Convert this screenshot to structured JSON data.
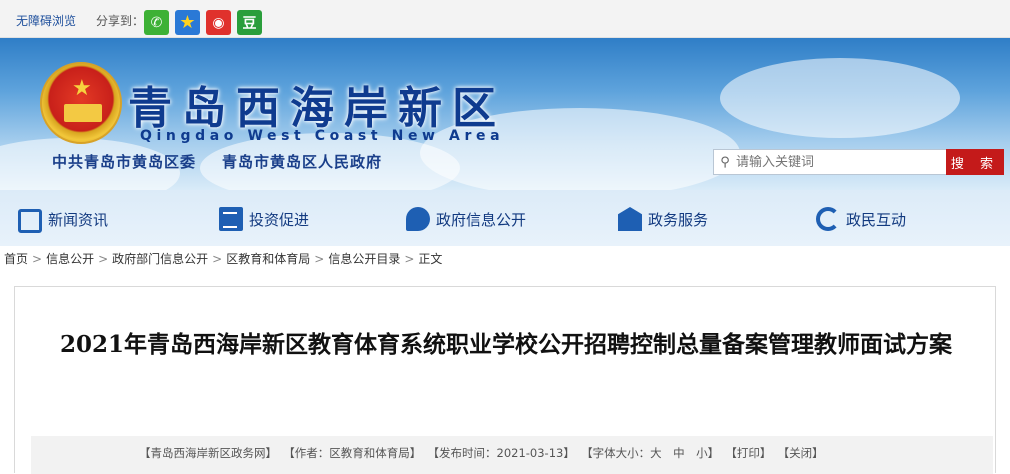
{
  "topbar": {
    "access_label": "无障碍浏览",
    "share_label": "分享到：",
    "share_icons": {
      "wechat": "wechat-icon",
      "qzone": "qzone-icon",
      "weibo": "weibo-icon",
      "douban": "豆"
    }
  },
  "header": {
    "title": "青岛西海岸新区",
    "subtitle": "Qingdao West Coast New Area",
    "org1": "中共青岛市黄岛区委",
    "org2": "青岛市黄岛区人民政府"
  },
  "search": {
    "placeholder": "请输入关键词",
    "button_label": "搜 索"
  },
  "nav": [
    {
      "label": "新闻资讯",
      "icon": "tv-icon"
    },
    {
      "label": "投资促进",
      "icon": "document-icon"
    },
    {
      "label": "政府信息公开",
      "icon": "chat-icon"
    },
    {
      "label": "政务服务",
      "icon": "building-icon"
    },
    {
      "label": "政民互动",
      "icon": "refresh-icon"
    }
  ],
  "breadcrumb": [
    "首页",
    "信息公开",
    "政府部门信息公开",
    "区教育和体育局",
    "信息公开目录",
    "正文"
  ],
  "article": {
    "title": "2021年青岛西海岸新区教育体育系统职业学校公开招聘控制总量备案管理教师面试方案",
    "meta": {
      "source": "【青岛西海岸新区政务网】",
      "author": "【作者：区教育和体育局】",
      "date": "【发布时间：2021-03-13】",
      "font_size": "【字体大小：大　中　小】",
      "print": "【打印】",
      "close": "【关闭】"
    }
  },
  "colors": {
    "brand_blue": "#0f3b8f",
    "search_red": "#c41a1a"
  }
}
